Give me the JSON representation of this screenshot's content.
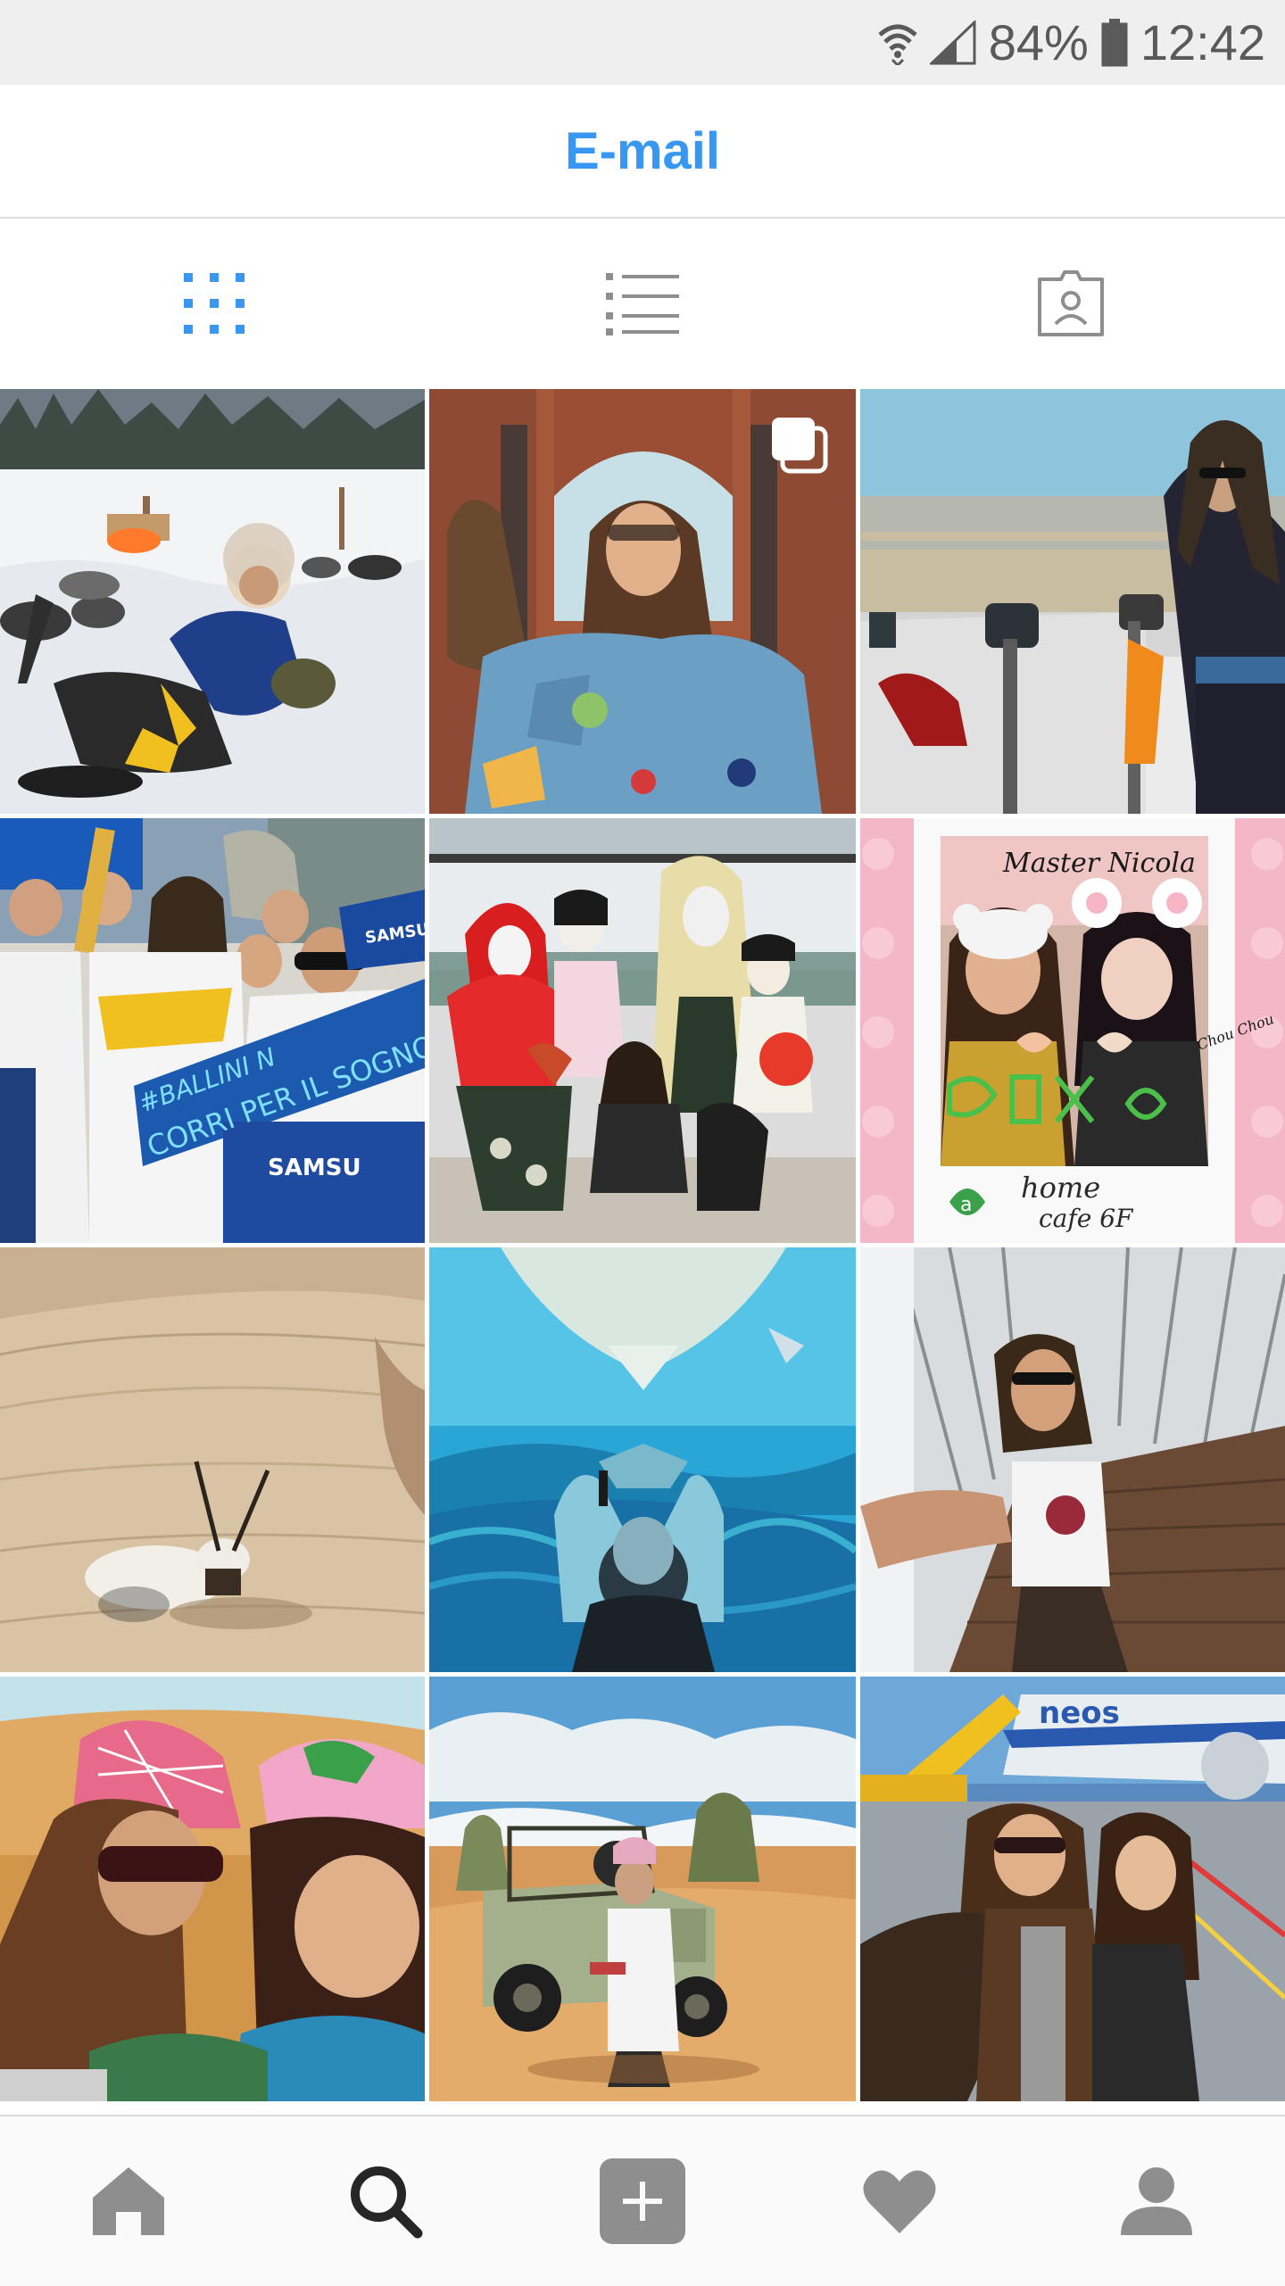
{
  "status_bar": {
    "battery_percent": "84%",
    "time": "12:42",
    "icons": [
      "wifi-icon",
      "signal-icon",
      "battery-icon"
    ]
  },
  "header": {
    "title": "E-mail"
  },
  "view_tabs": {
    "icons": [
      "grid-icon",
      "list-icon",
      "tagged-icon"
    ],
    "active": "grid-icon"
  },
  "grid": {
    "tiles": [
      {
        "scene": "sled dogs in snow"
      },
      {
        "scene": "two people under brick arches",
        "badge": "multiple-photos-icon"
      },
      {
        "scene": "observation deck with binoculars"
      },
      {
        "scene": "group holding banner",
        "banner_line1": "#BALLINI N",
        "banner_line2": "CORRI PER IL SOGNO",
        "flag_text": "SAMSUNG",
        "shirt_text": "SAMSU"
      },
      {
        "scene": "costumed performers"
      },
      {
        "scene": "instant photo",
        "photo_top": "Master Nicola",
        "caption_line1": "home",
        "caption_line2": "cafe 6F",
        "badge_letter": "a",
        "side_note": "Chou Chou"
      },
      {
        "scene": "oryx in desert"
      },
      {
        "scene": "aquarium with manta ray"
      },
      {
        "scene": "selfie on glass floor"
      },
      {
        "scene": "desert selfie"
      },
      {
        "scene": "vintage jeep in desert"
      },
      {
        "scene": "airport apron selfie",
        "plane_text": "neos"
      }
    ]
  },
  "bottom_nav": {
    "items": [
      "home-icon",
      "search-icon",
      "add-post-icon",
      "activity-heart-icon",
      "profile-icon"
    ],
    "active": "search-icon"
  },
  "colors": {
    "accent": "#3897f0",
    "inactive_icon": "#8e8e8e",
    "active_icon": "#262626"
  }
}
